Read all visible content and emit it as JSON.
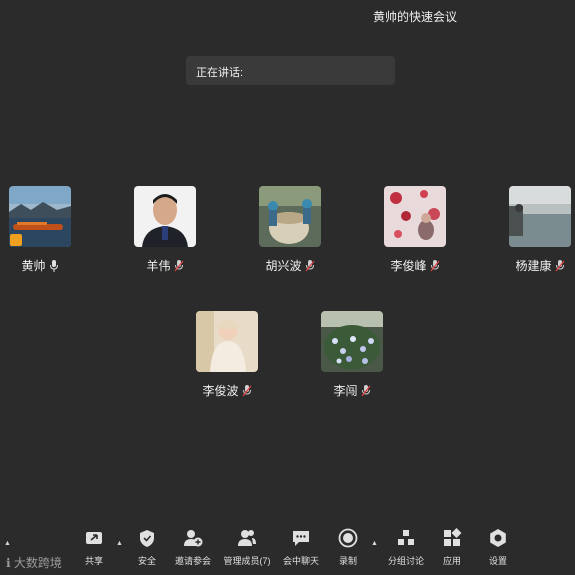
{
  "meeting": {
    "title": "黄帅的快速会议",
    "speaking_label": "正在讲话:"
  },
  "participants": [
    {
      "name": "黄帅",
      "mic": "mic-on",
      "host": true
    },
    {
      "name": "羊伟",
      "mic": "mic-muted"
    },
    {
      "name": "胡兴波",
      "mic": "mic-muted"
    },
    {
      "name": "李俊峰",
      "mic": "mic-muted"
    },
    {
      "name": "杨建康",
      "mic": "mic-muted"
    },
    {
      "name": "李俊波",
      "mic": "mic-muted"
    },
    {
      "name": "李闯",
      "mic": "mic-muted"
    }
  ],
  "toolbar": {
    "share": "共享",
    "security": "安全",
    "invite": "邀请参会",
    "members": "管理成员(7)",
    "chat": "会中聊天",
    "record": "录制",
    "breakout": "分组讨论",
    "apps": "应用",
    "settings": "设置"
  },
  "watermark": "大数跨境",
  "colors": {
    "background": "#2b2b2b",
    "panel": "#3a3a3a",
    "text": "#f0f0f0",
    "host_badge": "#f0a020"
  }
}
